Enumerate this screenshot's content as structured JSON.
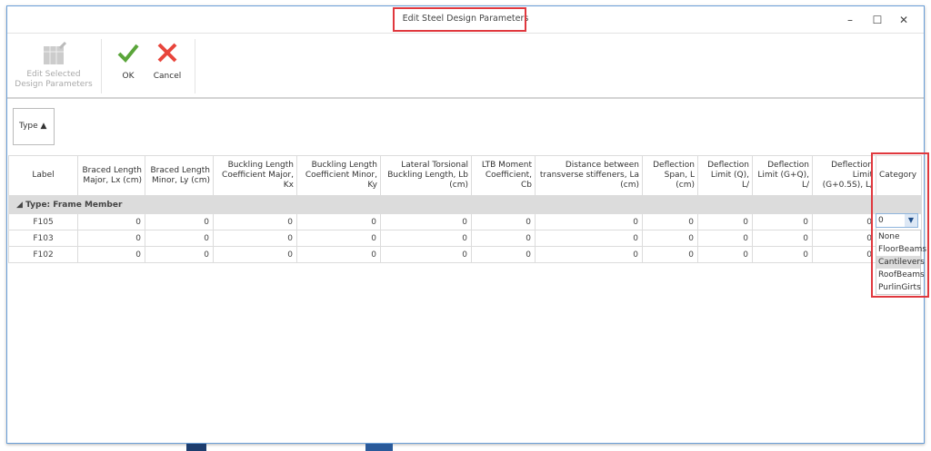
{
  "window": {
    "title": "Edit Steel Design Parameters",
    "minimize": "–",
    "maximize": "☐",
    "close": "✕"
  },
  "toolbar": {
    "edit_selected": "Edit Selected Design Parameters",
    "edit_line1": "Edit Selected",
    "edit_line2": "Design Parameters",
    "ok": "OK",
    "cancel": "Cancel"
  },
  "group_panel": {
    "chip": "Type ▲"
  },
  "grid": {
    "columns": [
      "Label",
      "Braced Length Major, Lx (cm)",
      "Braced Length Minor, Ly (cm)",
      "Buckling Length Coefficient Major, Kx",
      "Buckling Length Coefficient Minor, Ky",
      "Lateral Torsional Buckling Length, Lb (cm)",
      "LTB Moment Coefficient, Cb",
      "Distance between transverse stiffeners, La (cm)",
      "Deflection Span, L (cm)",
      "Deflection Limit (Q), L/",
      "Deflection Limit (G+Q), L/",
      "Deflection Limit (G+0.5S), L/",
      "Category"
    ],
    "group_label": "Type: Frame Member",
    "rows": [
      {
        "label": "F105",
        "values": [
          "0",
          "0",
          "0",
          "0",
          "0",
          "0",
          "0",
          "0",
          "0",
          "0",
          "0"
        ],
        "category": "0"
      },
      {
        "label": "F103",
        "values": [
          "0",
          "0",
          "0",
          "0",
          "0",
          "0",
          "0",
          "0",
          "0",
          "0",
          "0"
        ],
        "category": ""
      },
      {
        "label": "F102",
        "values": [
          "0",
          "0",
          "0",
          "0",
          "0",
          "0",
          "0",
          "0",
          "0",
          "0",
          "0"
        ],
        "category": ""
      }
    ]
  },
  "category_dropdown": {
    "value": "0",
    "options": [
      "None",
      "FloorBeams",
      "Cantilevers",
      "RoofBeams",
      "PurlinGirts"
    ],
    "highlighted": "Cantilevers"
  },
  "colors": {
    "highlight": "#e0383e",
    "ok": "#5aa53a",
    "cancel": "#e8453c",
    "border": "#6a9fd8"
  }
}
